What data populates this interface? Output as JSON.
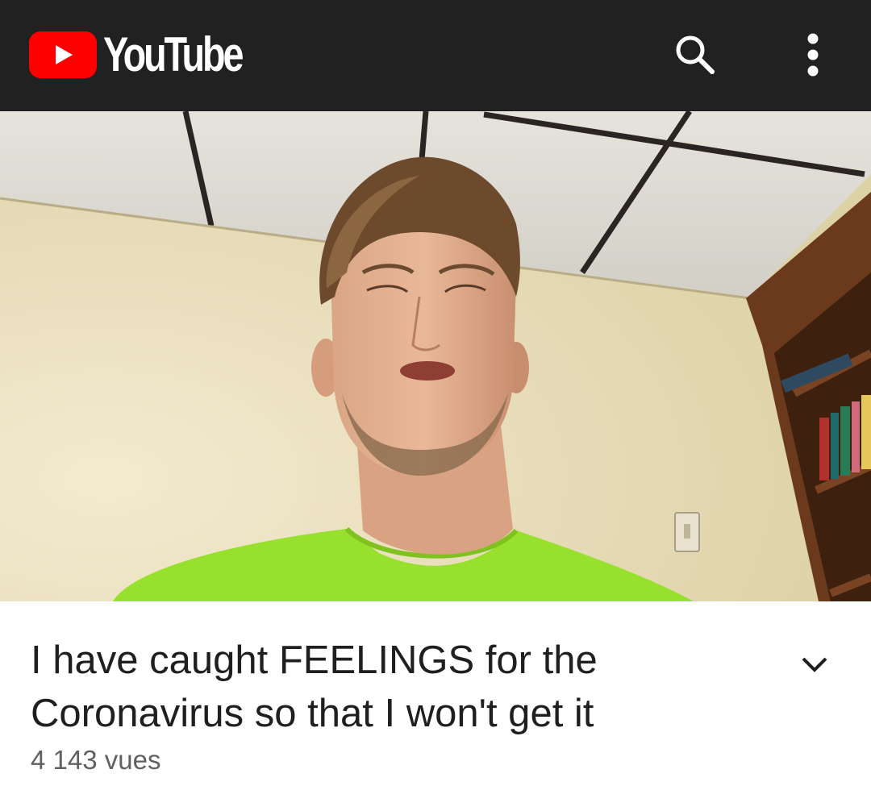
{
  "header": {
    "brand": "YouTube",
    "icons": [
      "play-logo-icon",
      "search-icon",
      "more-vertical-icon"
    ]
  },
  "video": {
    "thumbnail": "man in lime green shirt filmed from below in office with drop ceiling and bookshelf"
  },
  "details": {
    "title": "I have caught FEELINGS for the Coronavirus so that I won't get it",
    "views": "4 143 vues",
    "expand_icon": "chevron-down-icon"
  },
  "colors": {
    "topbar": "#212121",
    "brand_red": "#ff0000",
    "title_text": "#1f1f1f",
    "meta_text": "#606060"
  }
}
